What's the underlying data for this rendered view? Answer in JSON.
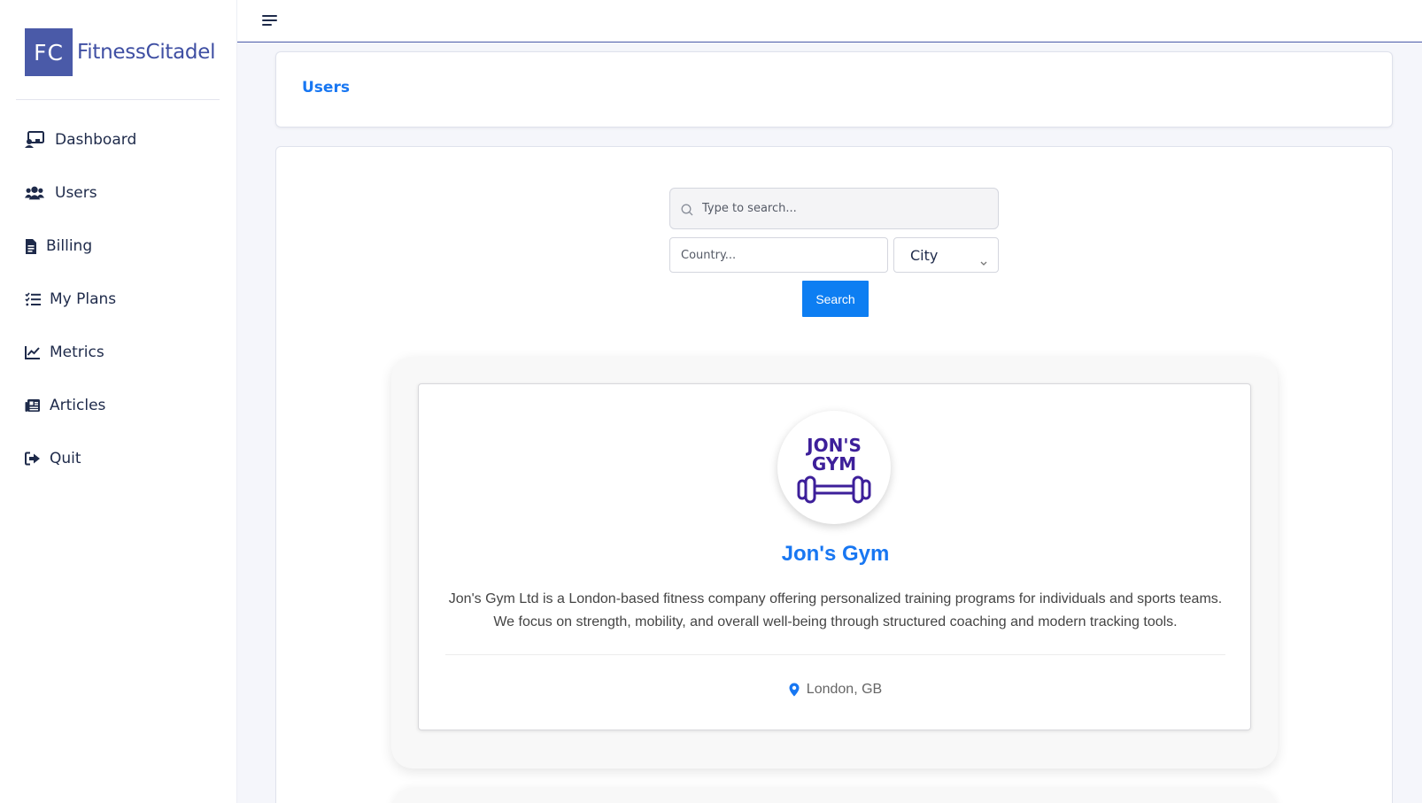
{
  "brand": {
    "initials": "FC",
    "name": "FitnessCitadel"
  },
  "sidebar": {
    "items": [
      {
        "label": "Dashboard",
        "icon": "dashboard-icon"
      },
      {
        "label": "Users",
        "icon": "users-icon"
      },
      {
        "label": "Billing",
        "icon": "billing-icon"
      },
      {
        "label": "My Plans",
        "icon": "plans-list-icon"
      },
      {
        "label": "Metrics",
        "icon": "chart-line-icon"
      },
      {
        "label": "Articles",
        "icon": "newspaper-icon"
      },
      {
        "label": "Quit",
        "icon": "sign-out-icon"
      }
    ]
  },
  "header": {
    "title": "Users"
  },
  "filters": {
    "search_placeholder": "Type to search...",
    "country_placeholder": "Country...",
    "city_selected": "City",
    "search_button": "Search"
  },
  "gym": {
    "logo_line1": "JON'S",
    "logo_line2": "GYM",
    "name": "Jon's Gym",
    "description_line1": "Jon's Gym Ltd is a London-based fitness company offering personalized training programs for individuals and sports teams.",
    "description_line2": "We focus on strength, mobility, and overall well-being through structured coaching and modern tracking tools.",
    "location": "London, GB"
  },
  "colors": {
    "brand": "#4a5aa8",
    "accent": "#1877f2",
    "button": "#0d7ef2",
    "logo": "#3d1f9a"
  }
}
